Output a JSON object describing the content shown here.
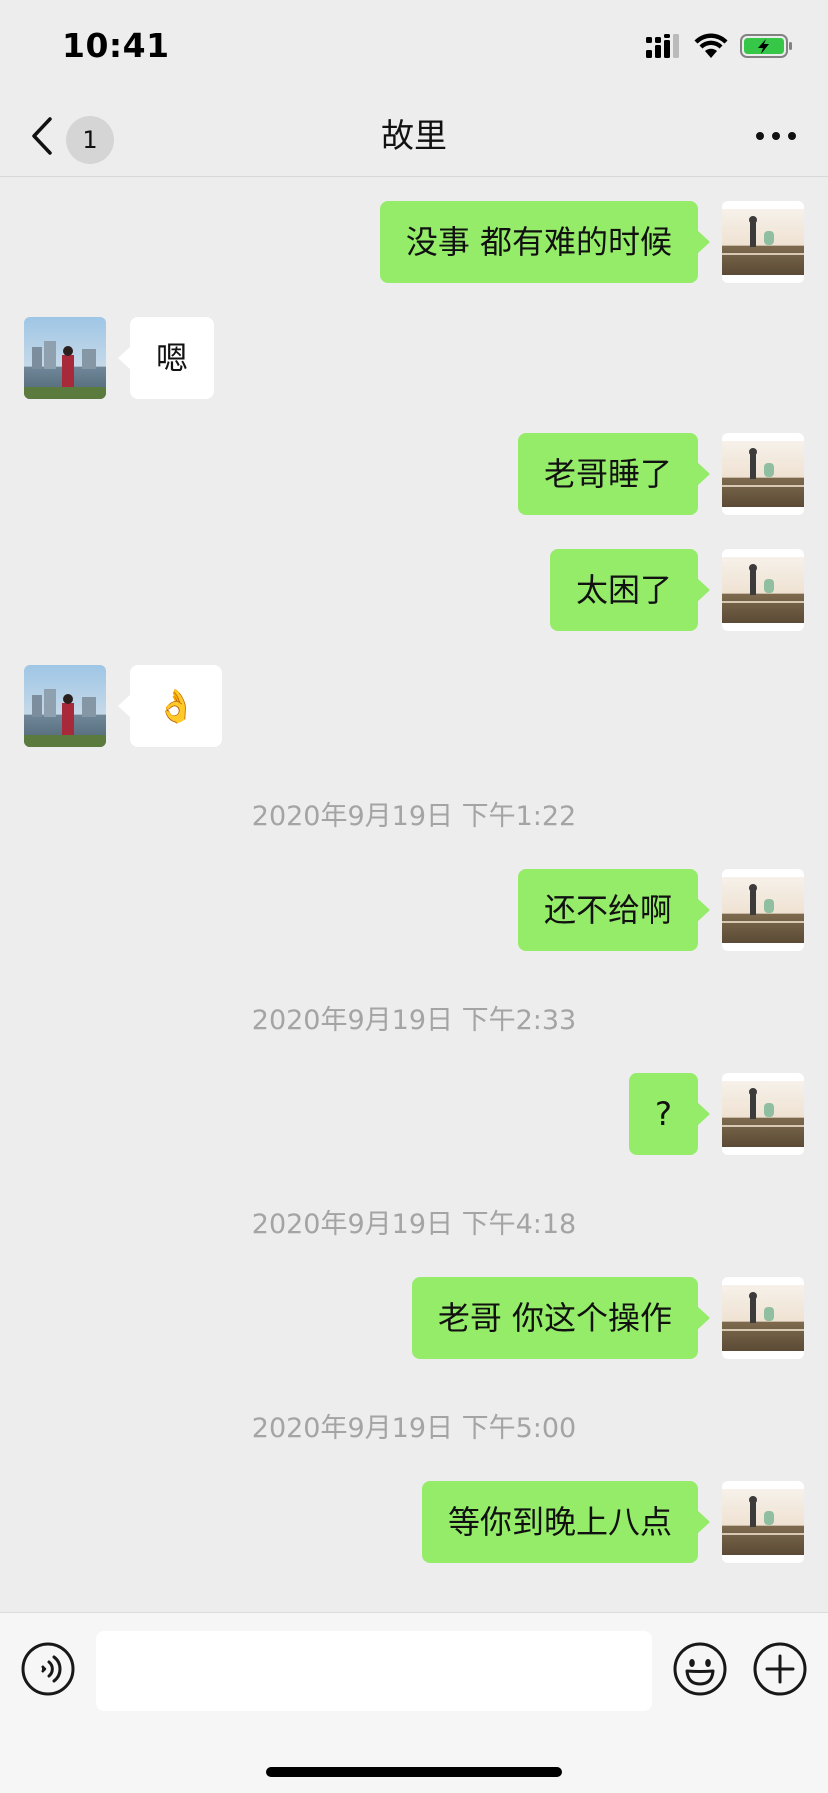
{
  "status_bar": {
    "time": "10:41"
  },
  "header": {
    "back_count": "1",
    "title": "故里"
  },
  "messages": [
    {
      "sender": "me",
      "text": "没事 都有难的时候"
    },
    {
      "sender": "other",
      "text": "嗯"
    },
    {
      "sender": "me",
      "text": "老哥睡了"
    },
    {
      "sender": "me",
      "text": "太困了"
    },
    {
      "sender": "other",
      "text": "👌"
    },
    {
      "timestamp": "2020年9月19日 下午1:22"
    },
    {
      "sender": "me",
      "text": "还不给啊"
    },
    {
      "timestamp": "2020年9月19日 下午2:33"
    },
    {
      "sender": "me",
      "text": "?"
    },
    {
      "timestamp": "2020年9月19日 下午4:18"
    },
    {
      "sender": "me",
      "text": "老哥 你这个操作"
    },
    {
      "timestamp": "2020年9月19日 下午5:00"
    },
    {
      "sender": "me",
      "text": "等你到晚上八点"
    }
  ],
  "input": {
    "value": "",
    "placeholder": ""
  },
  "icons": {
    "back": "chevron-left-icon",
    "more": "more-icon",
    "voice": "voice-icon",
    "emoji": "emoji-icon",
    "plus": "plus-icon"
  },
  "colors": {
    "background": "#ededed",
    "my_bubble": "#95ec69",
    "their_bubble": "#ffffff",
    "timestamp_text": "#a4a4a4",
    "battery_green": "#36c749"
  }
}
